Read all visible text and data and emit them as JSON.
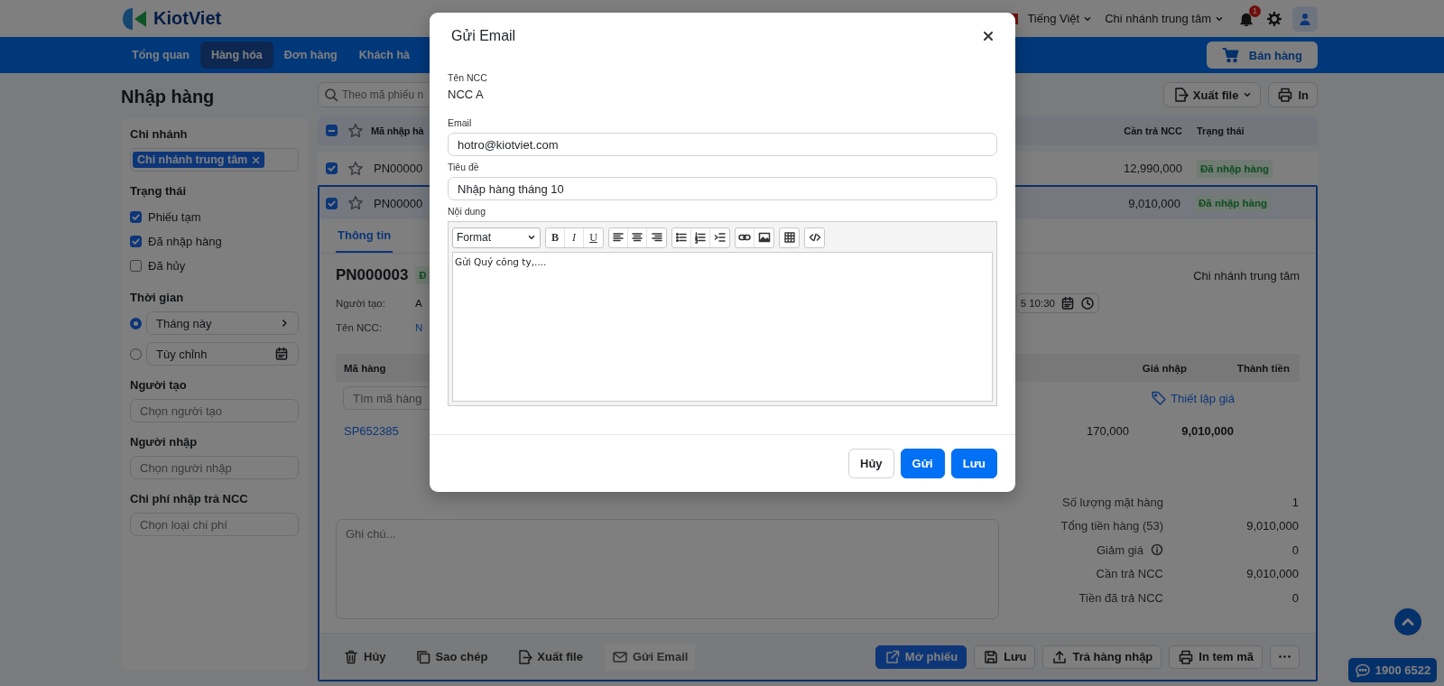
{
  "header": {
    "logo": "KiotViet",
    "language": "Tiếng Việt",
    "branch": "Chi nhánh trung tâm",
    "notifications": "1"
  },
  "nav": {
    "items": [
      {
        "label": "Tổng quan",
        "selected": false
      },
      {
        "label": "Hàng hóa",
        "selected": true
      },
      {
        "label": "Đơn hàng",
        "selected": false
      },
      {
        "label": "Khách hà",
        "selected": false
      }
    ],
    "sell_button": "Bán hàng"
  },
  "sidebar": {
    "title": "Nhập hàng",
    "sections": [
      {
        "kind": "tags",
        "label": "Chi nhánh",
        "tags": [
          "Chi nhánh trung tâm"
        ]
      },
      {
        "kind": "checks",
        "label": "Trạng thái",
        "options": [
          {
            "label": "Phiếu tạm",
            "checked": true
          },
          {
            "label": "Đã nhập hàng",
            "checked": true
          },
          {
            "label": "Đã hủy",
            "checked": false
          }
        ]
      },
      {
        "kind": "radios",
        "label": "Thời gian",
        "options": [
          {
            "label": "Tháng này",
            "selected": true,
            "kind": "next"
          },
          {
            "label": "Tùy chỉnh",
            "selected": false,
            "kind": "calendar"
          }
        ]
      },
      {
        "kind": "select",
        "label": "Người tạo",
        "placeholder": "Chọn người tạo"
      },
      {
        "kind": "select",
        "label": "Người nhập",
        "placeholder": "Chọn người nhập"
      },
      {
        "kind": "select",
        "label": "Chi phí nhập trả NCC",
        "placeholder": "Chọn loại chi phí"
      }
    ]
  },
  "toolbar": {
    "search_placeholder": "Theo mã phiếu n",
    "export": "Xuất file",
    "print": "In"
  },
  "table": {
    "select_all": {
      "checked": true,
      "partial": true
    },
    "columns": {
      "code": "Mã nhập hà",
      "amount": "Cần trả NCC",
      "status": "Trạng thái"
    },
    "rows": [
      {
        "code": "PN00000",
        "amount": "12,990,000",
        "status": "Đã nhập hàng",
        "checked": true,
        "expanded": false
      },
      {
        "code": "PN00000",
        "amount": "9,010,000",
        "status": "Đã nhập hàng",
        "checked": true,
        "expanded": true
      }
    ]
  },
  "detail": {
    "tabs": [
      {
        "label": "Thông tin",
        "selected": true
      }
    ],
    "code": "PN000003",
    "status": "Đ",
    "branch": "Chi nhánh trung tâm",
    "fields": [
      {
        "label": "Người tạo:",
        "value": "A",
        "kind": "text"
      },
      {
        "label": "Tên NCC:",
        "value": "N",
        "kind": "link"
      }
    ],
    "date": "5 10:30",
    "items": {
      "columns": {
        "code": "Mã hàng",
        "price": "Giá nhập",
        "total": "Thành tiền"
      },
      "search_placeholder": "Tìm mã hàng",
      "pricing_link": "Thiết lập giá",
      "rows": [
        {
          "code": "SP652385",
          "price": "170,000",
          "total": "9,010,000"
        }
      ]
    },
    "note_placeholder": "Ghi chú...",
    "summary": [
      {
        "label": "Số lượng mặt hàng",
        "value": "1",
        "info": false
      },
      {
        "label": "Tổng tiền hàng (53)",
        "value": "9,010,000",
        "info": false
      },
      {
        "label": "Giảm giá",
        "value": "0",
        "info": true
      },
      {
        "label": "Cần trả NCC",
        "value": "9,010,000",
        "info": false
      },
      {
        "label": "Tiền đã trả NCC",
        "value": "0",
        "info": false
      }
    ],
    "actions": [
      {
        "kind": "trash",
        "label": "Hủy",
        "selected": false
      },
      {
        "kind": "copy",
        "label": "Sao chép",
        "selected": false
      },
      {
        "kind": "export",
        "label": "Xuất file",
        "selected": false
      },
      {
        "kind": "mail",
        "label": "Gửi Email",
        "selected": true
      }
    ],
    "main_actions": [
      {
        "kind": "open",
        "label": "Mở phiếu",
        "primary": true
      },
      {
        "kind": "save",
        "label": "Lưu",
        "primary": false
      },
      {
        "kind": "upload",
        "label": "Trả hàng nhập",
        "primary": false
      },
      {
        "kind": "print",
        "label": "In tem mã",
        "primary": false
      },
      {
        "kind": "more",
        "primary": false
      }
    ]
  },
  "hotline": "1900 6522",
  "modal": {
    "title": "Gửi Email",
    "fields": [
      {
        "kind": "static",
        "label": "Tên NCC",
        "value": "NCC A"
      },
      {
        "kind": "input",
        "label": "Email",
        "value": "hotro@kiotviet.com"
      },
      {
        "kind": "input",
        "label": "Tiêu đề",
        "value": "Nhập hàng tháng 10"
      },
      {
        "kind": "editor",
        "label": "Nội dung",
        "value": "Gửi Quý công ty,...."
      }
    ],
    "editor_toolbar": [
      {
        "kind": "format",
        "label": "Format"
      },
      {
        "kind": "group",
        "buttons": [
          {
            "kind": "bold",
            "label": "B"
          },
          {
            "kind": "italic",
            "label": "I"
          },
          {
            "kind": "underline",
            "label": "U"
          }
        ]
      },
      {
        "kind": "group",
        "buttons": [
          {
            "kind": "left"
          },
          {
            "kind": "center"
          },
          {
            "kind": "right"
          }
        ]
      },
      {
        "kind": "group",
        "buttons": [
          {
            "kind": "bullets"
          },
          {
            "kind": "numbers"
          },
          {
            "kind": "indent"
          }
        ]
      },
      {
        "kind": "group",
        "buttons": [
          {
            "kind": "link"
          },
          {
            "kind": "image"
          }
        ]
      },
      {
        "kind": "group",
        "buttons": [
          {
            "kind": "table"
          }
        ]
      },
      {
        "kind": "group",
        "buttons": [
          {
            "kind": "source"
          }
        ]
      }
    ],
    "buttons": [
      {
        "kind": "secondary",
        "label": "Hủy"
      },
      {
        "kind": "primary",
        "label": "Gửi"
      },
      {
        "kind": "primary",
        "label": "Lưu"
      }
    ]
  }
}
